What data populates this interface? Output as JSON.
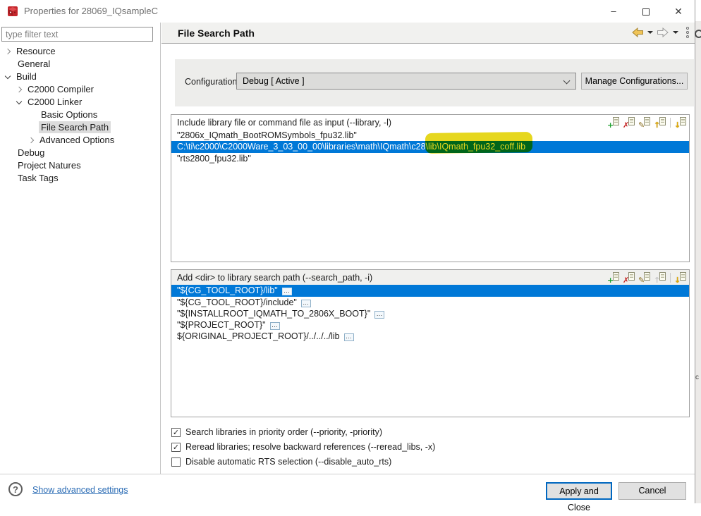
{
  "window": {
    "title": "Properties for 28069_IQsampleC",
    "controls": {
      "minimize": "–",
      "close": "✕"
    }
  },
  "sidebar": {
    "filter_placeholder": "type filter text",
    "tree": [
      {
        "label": "Resource"
      },
      {
        "label": "General"
      },
      {
        "label": "Build"
      },
      {
        "label": "C2000 Compiler"
      },
      {
        "label": "C2000 Linker"
      },
      {
        "label": "Basic Options"
      },
      {
        "label": "File Search Path"
      },
      {
        "label": "Advanced Options"
      },
      {
        "label": "Debug"
      },
      {
        "label": "Project Natures"
      },
      {
        "label": "Task Tags"
      }
    ]
  },
  "header": {
    "title": "File Search Path"
  },
  "configuration": {
    "label": "Configuration:",
    "value": "Debug  [ Active ]",
    "manage_button": "Manage Configurations..."
  },
  "include_list": {
    "title": "Include library file or command file as input (--library, -l)",
    "items": [
      {
        "text": "\"2806x_IQmath_BootROMSymbols_fpu32.lib\""
      },
      {
        "text_pre": "C:\\ti\\c2000\\C2000Ware_3_03_00_00\\libraries\\math\\IQmath\\c28\\",
        "text_highlight": "lib\\IQmath_fpu32_coff.lib"
      },
      {
        "text": "\"rts2800_fpu32.lib\""
      }
    ]
  },
  "search_list": {
    "title": "Add <dir> to library search path (--search_path, -i)",
    "items": [
      {
        "text": "\"${CG_TOOL_ROOT}/lib\""
      },
      {
        "text": "\"${CG_TOOL_ROOT}/include\""
      },
      {
        "text": "\"${INSTALLROOT_IQMATH_TO_2806X_BOOT}\""
      },
      {
        "text": "\"${PROJECT_ROOT}\""
      },
      {
        "text": "${ORIGINAL_PROJECT_ROOT}/../../../lib"
      }
    ],
    "badge_glyph": "…"
  },
  "icons": {
    "add": "+",
    "delete": "✗",
    "edit": "✎",
    "up": "↑",
    "down": "↓",
    "help": "?"
  },
  "checkboxes": [
    {
      "label": "Search libraries in priority order (--priority, -priority)",
      "mark": "✓"
    },
    {
      "label": "Reread libraries; resolve backward references (--reread_libs, -x)",
      "mark": "✓"
    },
    {
      "label": "Disable automatic RTS selection (--disable_auto_rts)",
      "mark": ""
    }
  ],
  "footer": {
    "link": "Show advanced settings",
    "apply_button": "Apply and Close",
    "cancel_button": "Cancel"
  },
  "background_window": {
    "partial_text": "c"
  },
  "colors": {
    "selection_blue": "#0078d7",
    "marker_yellow": "#e6d71e",
    "focus_border_blue": "#0067c0",
    "link_blue": "#2b6cb5",
    "app_icon_red": "#c4262c"
  }
}
